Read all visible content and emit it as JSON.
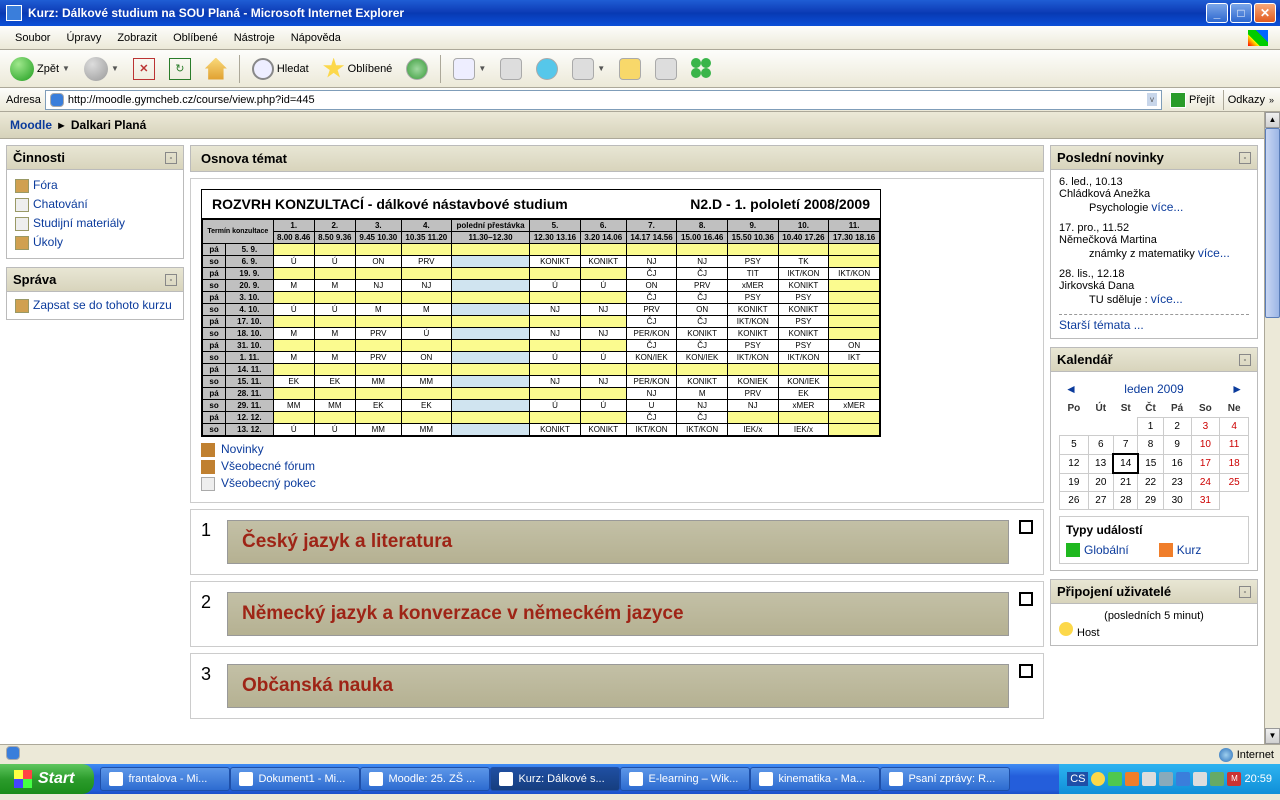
{
  "titlebar": {
    "text": "Kurz: Dálkové studium na SOU Planá - Microsoft Internet Explorer"
  },
  "menu": {
    "items": [
      "Soubor",
      "Úpravy",
      "Zobrazit",
      "Oblíbené",
      "Nástroje",
      "Nápověda"
    ]
  },
  "toolbar": {
    "back": "Zpět",
    "search": "Hledat",
    "fav": "Oblíbené"
  },
  "addr": {
    "label": "Adresa",
    "url": "http://moodle.gymcheb.cz/course/view.php?id=445",
    "go": "Přejít",
    "links": "Odkazy"
  },
  "breadcrumb": {
    "root": "Moodle",
    "current": "Dalkari Planá"
  },
  "left": {
    "activities_title": "Činnosti",
    "activities": [
      "Fóra",
      "Chatování",
      "Studijní materiály",
      "Úkoly"
    ],
    "admin_title": "Správa",
    "admin_link": "Zapsat se do tohoto kurzu"
  },
  "mid": {
    "outline": "Osnova témat",
    "sched_title": "ROZVRH KONZULTACÍ - dálkové nástavbové studium",
    "sched_sub": "N2.D - 1. pololetí 2008/2009",
    "head_day": "Termín konzultace",
    "periods": [
      "1.",
      "2.",
      "3.",
      "4.",
      "polední přestávka",
      "5.",
      "6.",
      "7.",
      "8.",
      "9.",
      "10.",
      "11."
    ],
    "times": [
      "8.00 8.46",
      "8.50 9.36",
      "9.45 10.30",
      "10.35 11.20",
      "11.30–12.30",
      "12.30 13.16",
      "3.20 14.06",
      "14.17 14.56",
      "15.00 16.46",
      "15.50 10.36",
      "10.40 17.26",
      "17.30 18.16"
    ],
    "rows": [
      {
        "d": "pá",
        "dt": "5. 9.",
        "c": [
          "",
          "",
          "",
          "",
          "",
          "",
          "",
          "",
          "",
          "",
          "",
          ""
        ],
        "cls": [
          "y",
          "y",
          "y",
          "y",
          "y",
          "y",
          "y",
          "y",
          "y",
          "y",
          "y",
          "y"
        ]
      },
      {
        "d": "so",
        "dt": "6. 9.",
        "c": [
          "Ú",
          "Ú",
          "ON",
          "PRV",
          "",
          "KONIKT",
          "KONIKT",
          "NJ",
          "NJ",
          "PSY",
          "TK",
          ""
        ],
        "cls": [
          "",
          "",
          "",
          "",
          "lb",
          "",
          "",
          "",
          "",
          "",
          "",
          "y"
        ]
      },
      {
        "d": "pá",
        "dt": "19. 9.",
        "c": [
          "",
          "",
          "",
          "",
          "",
          "",
          "",
          "ČJ",
          "ČJ",
          "TIT",
          "IKT/KON",
          "IKT/KON"
        ],
        "cls": [
          "y",
          "y",
          "y",
          "y",
          "y",
          "y",
          "y",
          "",
          "",
          "",
          "",
          ""
        ]
      },
      {
        "d": "so",
        "dt": "20. 9.",
        "c": [
          "M",
          "M",
          "NJ",
          "NJ",
          "",
          "Ú",
          "Ú",
          "ON",
          "PRV",
          "xMER",
          "KONIKT",
          ""
        ],
        "cls": [
          "",
          "",
          "",
          "",
          "lb",
          "",
          "",
          "",
          "",
          "",
          "",
          "y"
        ]
      },
      {
        "d": "pá",
        "dt": "3. 10.",
        "c": [
          "",
          "",
          "",
          "",
          "",
          "",
          "",
          "ČJ",
          "ČJ",
          "PSY",
          "PSY",
          ""
        ],
        "cls": [
          "y",
          "y",
          "y",
          "y",
          "y",
          "y",
          "y",
          "",
          "",
          "",
          "",
          "y"
        ]
      },
      {
        "d": "so",
        "dt": "4. 10.",
        "c": [
          "Ú",
          "Ú",
          "M",
          "M",
          "",
          "NJ",
          "NJ",
          "PRV",
          "ON",
          "KONIKT",
          "KONIKT",
          ""
        ],
        "cls": [
          "",
          "",
          "",
          "",
          "lb",
          "",
          "",
          "",
          "",
          "",
          "",
          "y"
        ]
      },
      {
        "d": "pá",
        "dt": "17. 10.",
        "c": [
          "",
          "",
          "",
          "",
          "",
          "",
          "",
          "ČJ",
          "ČJ",
          "IKT/KON",
          "PSY",
          ""
        ],
        "cls": [
          "y",
          "y",
          "y",
          "y",
          "y",
          "y",
          "y",
          "",
          "",
          "",
          "",
          "y"
        ]
      },
      {
        "d": "so",
        "dt": "18. 10.",
        "c": [
          "M",
          "M",
          "PRV",
          "Ú",
          "",
          "NJ",
          "NJ",
          "PER/KON",
          "KONIKT",
          "KONIKT",
          "KONIKT",
          ""
        ],
        "cls": [
          "",
          "",
          "",
          "",
          "lb",
          "",
          "",
          "",
          "",
          "",
          "",
          "y"
        ]
      },
      {
        "d": "pá",
        "dt": "31. 10.",
        "c": [
          "",
          "",
          "",
          "",
          "",
          "",
          "",
          "ČJ",
          "ČJ",
          "PSY",
          "PSY",
          "ON"
        ],
        "cls": [
          "y",
          "y",
          "y",
          "y",
          "y",
          "y",
          "y",
          "",
          "",
          "",
          "",
          ""
        ]
      },
      {
        "d": "so",
        "dt": "1. 11.",
        "c": [
          "M",
          "M",
          "PRV",
          "ON",
          "",
          "Ú",
          "Ú",
          "KON/IEK",
          "KON/IEK",
          "IKT/KON",
          "IKT/KON",
          "IKT"
        ],
        "cls": [
          "",
          "",
          "",
          "",
          "lb",
          "",
          "",
          "",
          "",
          "",
          "",
          ""
        ]
      },
      {
        "d": "pá",
        "dt": "14. 11.",
        "c": [
          "",
          "",
          "",
          "",
          "",
          "",
          "",
          "",
          "",
          "",
          "",
          ""
        ],
        "cls": [
          "y",
          "y",
          "y",
          "y",
          "y",
          "y",
          "y",
          "y",
          "y",
          "y",
          "y",
          "y"
        ]
      },
      {
        "d": "so",
        "dt": "15. 11.",
        "c": [
          "EK",
          "EK",
          "MM",
          "MM",
          "",
          "NJ",
          "NJ",
          "PER/KON",
          "KONIKT",
          "KONIEK",
          "KON/IEK",
          ""
        ],
        "cls": [
          "",
          "",
          "",
          "",
          "lb",
          "",
          "",
          "",
          "",
          "",
          "",
          "y"
        ]
      },
      {
        "d": "pá",
        "dt": "28. 11.",
        "c": [
          "",
          "",
          "",
          "",
          "",
          "",
          "",
          "NJ",
          "M",
          "PRV",
          "EK",
          ""
        ],
        "cls": [
          "y",
          "y",
          "y",
          "y",
          "y",
          "y",
          "y",
          "",
          "",
          "",
          "",
          "y"
        ]
      },
      {
        "d": "so",
        "dt": "29. 11.",
        "c": [
          "MM",
          "MM",
          "EK",
          "EK",
          "",
          "Ú",
          "Ú",
          "U",
          "NJ",
          "NJ",
          "xMER",
          "xMER"
        ],
        "cls": [
          "",
          "",
          "",
          "",
          "lb",
          "",
          "",
          "",
          "",
          "",
          "",
          ""
        ]
      },
      {
        "d": "pá",
        "dt": "12. 12.",
        "c": [
          "",
          "",
          "",
          "",
          "",
          "",
          "",
          "ČJ",
          "ČJ",
          "",
          "",
          ""
        ],
        "cls": [
          "y",
          "y",
          "y",
          "y",
          "y",
          "y",
          "y",
          "",
          "",
          "y",
          "y",
          "y"
        ]
      },
      {
        "d": "so",
        "dt": "13. 12.",
        "c": [
          "Ú",
          "Ú",
          "MM",
          "MM",
          "",
          "KONIKT",
          "KONIKT",
          "IKT/KON",
          "IKT/KON",
          "IEK/x",
          "IEK/x",
          ""
        ],
        "cls": [
          "",
          "",
          "",
          "",
          "lb",
          "",
          "",
          "",
          "",
          "",
          "",
          "y"
        ]
      }
    ],
    "links": [
      "Novinky",
      "Všeobecné fórum",
      "Všeobecný pokec"
    ],
    "sections": [
      {
        "n": "1",
        "t": "Český jazyk a literatura"
      },
      {
        "n": "2",
        "t": "Německý jazyk a konverzace v německém jazyce"
      },
      {
        "n": "3",
        "t": "Občanská nauka"
      }
    ]
  },
  "right": {
    "news_title": "Poslední novinky",
    "news": [
      {
        "date": "6. led., 10.13",
        "author": "Chládková Anežka",
        "topic": "Psychologie",
        "more": "více..."
      },
      {
        "date": "17. pro., 11.52",
        "author": "Němečková Martina",
        "topic": "známky z matematiky",
        "more": "více..."
      },
      {
        "date": "28. lis., 12.18",
        "author": "Jirkovská Dana",
        "topic": "TU sděluje :",
        "more": "více..."
      }
    ],
    "old_topics": "Starší témata ...",
    "cal_title": "Kalendář",
    "cal_month": "leden 2009",
    "cal_days": [
      "Po",
      "Út",
      "St",
      "Čt",
      "Pá",
      "So",
      "Ne"
    ],
    "cal_grid": [
      [
        "",
        "",
        "",
        "1",
        "2",
        "3",
        "4"
      ],
      [
        "5",
        "6",
        "7",
        "8",
        "9",
        "10",
        "11"
      ],
      [
        "12",
        "13",
        "14",
        "15",
        "16",
        "17",
        "18"
      ],
      [
        "19",
        "20",
        "21",
        "22",
        "23",
        "24",
        "25"
      ],
      [
        "26",
        "27",
        "28",
        "29",
        "30",
        "31",
        ""
      ]
    ],
    "cal_today": "14",
    "ev_title": "Typy událostí",
    "ev_global": "Globální",
    "ev_course": "Kurz",
    "online_title": "Připojení uživatelé",
    "online_sub": "(posledních 5 minut)",
    "online_user": "Host"
  },
  "status": {
    "zone": "Internet"
  },
  "taskbar": {
    "start": "Start",
    "items": [
      {
        "l": "frantalova - Mi...",
        "a": false
      },
      {
        "l": "Dokument1 - Mi...",
        "a": false
      },
      {
        "l": "Moodle: 25. ZŠ ...",
        "a": false
      },
      {
        "l": "Kurz: Dálkové s...",
        "a": true
      },
      {
        "l": "E-learning – Wik...",
        "a": false
      },
      {
        "l": "kinematika - Ma...",
        "a": false
      },
      {
        "l": "Psaní zprávy: R...",
        "a": false
      }
    ],
    "lang": "CS",
    "clock": "20:59"
  }
}
